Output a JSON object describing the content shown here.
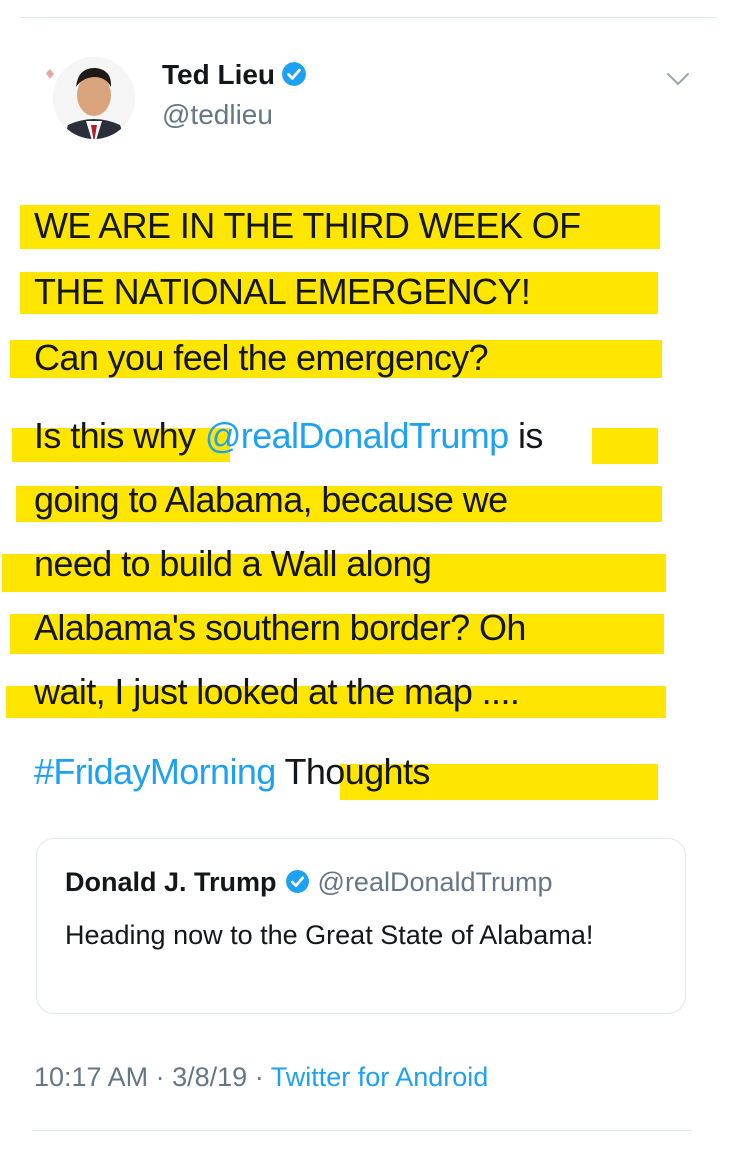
{
  "author": {
    "name": "Ted Lieu",
    "handle": "@tedlieu",
    "verified": true,
    "avatar_icon": "profile-photo"
  },
  "menu_icon": "chevron-down-icon",
  "tweet": {
    "highlight_color": "#ffe600",
    "lines": [
      {
        "segments": [
          {
            "text": "WE ARE IN THE THIRD WEEK OF",
            "link": false
          }
        ]
      },
      {
        "segments": [
          {
            "text": "THE NATIONAL EMERGENCY!",
            "link": false
          }
        ]
      },
      {
        "segments": [
          {
            "text": "Can you feel the emergency?",
            "link": false
          }
        ]
      },
      {
        "segments": [
          {
            "text": "Is this why ",
            "link": false
          },
          {
            "text": "@realDonaldTrump",
            "link": true
          },
          {
            "text": " is",
            "link": false
          }
        ]
      },
      {
        "segments": [
          {
            "text": "going to Alabama, because we",
            "link": false
          }
        ]
      },
      {
        "segments": [
          {
            "text": "need to build a Wall along",
            "link": false
          }
        ]
      },
      {
        "segments": [
          {
            "text": "Alabama's southern border? Oh",
            "link": false
          }
        ]
      },
      {
        "segments": [
          {
            "text": "wait, I just looked at the map ....",
            "link": false
          }
        ]
      },
      {
        "segments": [
          {
            "text": "#FridayMorning",
            "link": true
          },
          {
            "text": " Thoughts",
            "link": false
          }
        ]
      }
    ]
  },
  "quoted_tweet": {
    "name": "Donald J. Trump",
    "handle": "@realDonaldTrump",
    "verified": true,
    "text": "Heading now to the Great State of Alabama!"
  },
  "meta": {
    "time": "10:17 AM",
    "separator": "·",
    "date": "3/8/19",
    "source": "Twitter for Android"
  },
  "colors": {
    "link": "#1da1f2",
    "secondary_text": "#657786",
    "verified_badge": "#1da1f2"
  }
}
